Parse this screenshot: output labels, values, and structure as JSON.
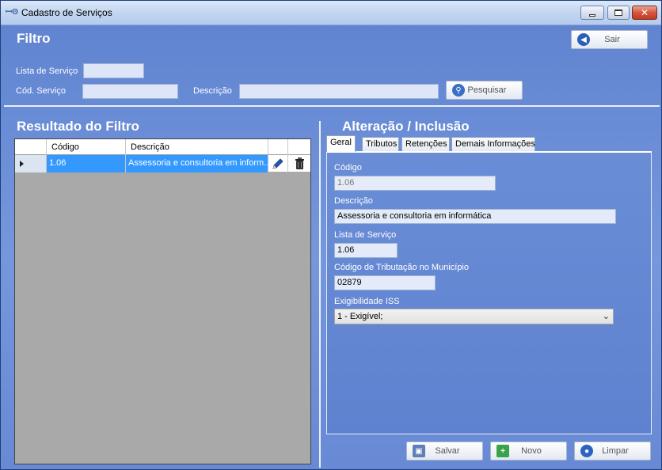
{
  "window": {
    "title": "Cadastro de Serviços",
    "close_glyph": "✕"
  },
  "filter": {
    "heading": "Filtro",
    "lista_servico_label": "Lista de Serviço",
    "lista_servico_value": "",
    "cod_servico_label": "Cód. Serviço",
    "cod_servico_value": "",
    "descricao_label": "Descrição",
    "descricao_value": "",
    "pesquisar_label": "Pesquisar",
    "sair_label": "Sair"
  },
  "results": {
    "heading": "Resultado do Filtro",
    "columns": [
      "Código",
      "Descrição"
    ],
    "rows": [
      {
        "codigo": "1.06",
        "descricao": "Assessoria e consultoria em inform..."
      }
    ]
  },
  "edit": {
    "heading": "Alteração / Inclusão",
    "tabs": [
      "Geral",
      "Tributos",
      "Retenções",
      "Demais Informações"
    ],
    "codigo_label": "Código",
    "codigo_value": "1.06",
    "descricao_label": "Descrição",
    "descricao_value": "Assessoria e consultoria em informática",
    "lista_label": "Lista de Serviço",
    "lista_value": "1.06",
    "cod_trib_label": "Código de Tributação no Município",
    "cod_trib_value": "02879",
    "exig_label": "Exigibilidade ISS",
    "exig_value": "1 - Exigível;"
  },
  "actions": {
    "salvar": "Salvar",
    "novo": "Novo",
    "limpar": "Limpar"
  },
  "colors": {
    "background": "#6e8fd2",
    "selection": "#3399ff"
  },
  "icons": [
    "app-icon",
    "minimize-icon",
    "maximize-icon",
    "close-icon",
    "exit-icon",
    "search-icon",
    "edit-pencil-icon",
    "delete-trash-icon",
    "save-disk-icon",
    "add-new-icon",
    "clear-icon",
    "row-pointer-icon",
    "chevron-down-icon"
  ]
}
